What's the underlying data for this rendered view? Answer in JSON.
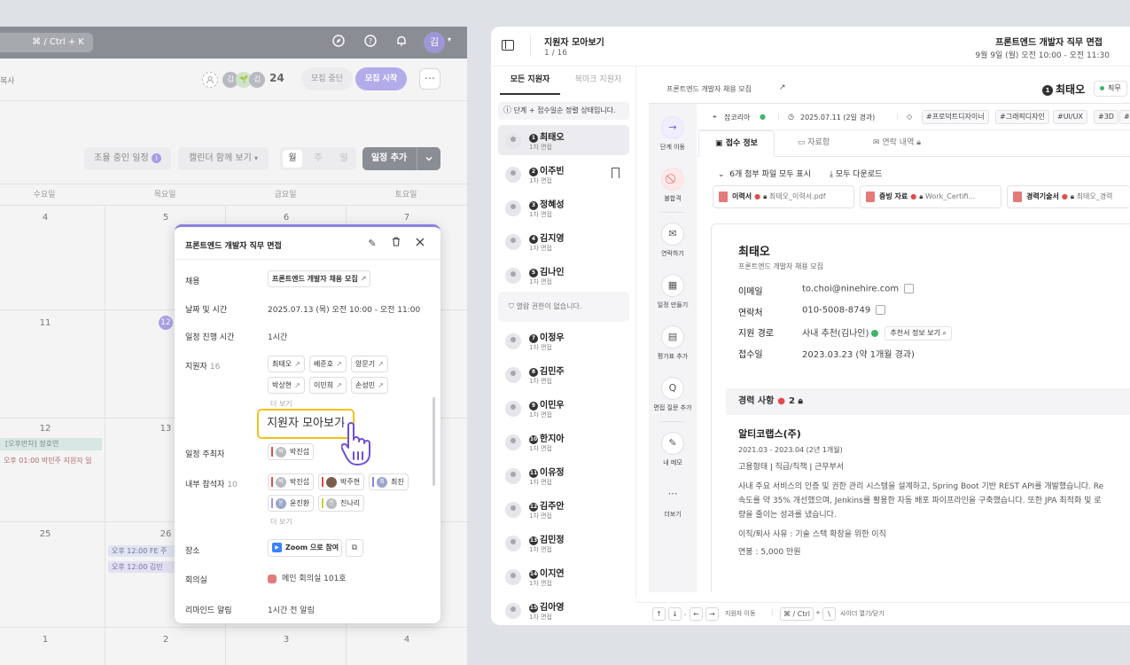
{
  "calendar": {
    "search_shortcut": "⌘ / Ctrl + K",
    "avatar_initial": "김",
    "copy_label": "복사",
    "member_avatars": [
      "김",
      "🌱",
      "김"
    ],
    "member_count": "24",
    "close_recruit": "모집 중단",
    "start_recruit": "모집 시작",
    "coordinating": "조율 중인 일정",
    "calendar_view": "캘린더 함께 보기",
    "view_month": "월",
    "view_week": "주",
    "view_day": "일",
    "add_schedule": "일정 추가",
    "day_names": [
      "수요일",
      "목요일",
      "금요일",
      "토요일"
    ],
    "dates_row1": [
      "4",
      "5",
      "6",
      "7"
    ],
    "dates_row2": [
      "11",
      "12"
    ],
    "dates_row3": [
      "12",
      "13"
    ],
    "dates_row4": [
      "25",
      "26"
    ],
    "dates_row5": [
      "1",
      "2",
      "3",
      "4"
    ],
    "events": {
      "e1": "[오후반차] 정호연",
      "e2": "오후 01:00  박민주 지원자 일",
      "e3": "오후 12:00  FE 주",
      "e4": "오후 12:00  김민"
    }
  },
  "popup": {
    "title": "프론트엔드 개발자 직무 면접",
    "label_recruit": "채용",
    "recruit_value": "프론트엔드 개발자 채용 모집",
    "label_datetime": "날짜 및 시간",
    "datetime_value": "2025.07.13 (목) 오전 10:00 - 오전 11:00",
    "label_duration": "일정 진행 시간",
    "duration_value": "1시간",
    "label_applicants": "지원자",
    "applicant_count": "16",
    "applicants": [
      "최태오",
      "배준호",
      "양문기",
      "박상현",
      "이민희",
      "손성민"
    ],
    "more": "더 보기",
    "collect_view": "지원자 모아보기",
    "label_host": "일정 주최자",
    "host": "박진섭",
    "host_initial": "박",
    "label_participants": "내부 참석자",
    "participant_count": "10",
    "participants": [
      "박진섭",
      "박주현",
      "최진",
      "윤진환",
      "진나리"
    ],
    "participant_initials": [
      "박",
      "",
      "최",
      "윤",
      "진"
    ],
    "label_place": "장소",
    "zoom": "Zoom 으로 참여",
    "label_room": "회의실",
    "room_value": "메인 회의실 101호",
    "label_reminder": "리마인드 알림",
    "reminder_value": "1시간 전 알림"
  },
  "window": {
    "title": "지원자 모아보기",
    "page": "1 / 16",
    "interview_title": "프론트엔드 개발자 직무 면접",
    "interview_time": "9월 9일 (월) 오전 10:00 - 오전 11:30",
    "tab_all": "모든 지원자",
    "tab_bookmark": "북마크 지원자",
    "note": "단계 + 접수일순 정렬 상태입니다.",
    "applicants": [
      {
        "num": "1",
        "name": "최태오",
        "stage": "1차 면접"
      },
      {
        "num": "2",
        "name": "이주빈",
        "stage": "1차 면접"
      },
      {
        "num": "3",
        "name": "정혜성",
        "stage": "1차 면접"
      },
      {
        "num": "4",
        "name": "김지영",
        "stage": "1차 면접"
      },
      {
        "num": "5",
        "name": "김나인",
        "stage": "1차 면접"
      },
      {
        "num": "7",
        "name": "이정우",
        "stage": "1차 면접"
      },
      {
        "num": "8",
        "name": "김민주",
        "stage": "1차 면접"
      },
      {
        "num": "9",
        "name": "이민우",
        "stage": "1차 면접"
      },
      {
        "num": "10",
        "name": "한지아",
        "stage": "1차 면접"
      },
      {
        "num": "11",
        "name": "이유정",
        "stage": "1차 면접"
      },
      {
        "num": "12",
        "name": "김주안",
        "stage": "1차 면접"
      },
      {
        "num": "13",
        "name": "김민정",
        "stage": "1차 면접"
      },
      {
        "num": "14",
        "name": "이지연",
        "stage": "1차 면접"
      },
      {
        "num": "15",
        "name": "김아영",
        "stage": "1차 면접"
      }
    ],
    "no_permission": "열람 권한이 없습니다.",
    "footer": {
      "up": "↑",
      "down": "↓",
      "left": "←",
      "right": "→",
      "move_label": "지원자 이동",
      "mod": "⌘ / Ctrl",
      "plus": "+",
      "slash": "\\",
      "sidebar_label": "사이더 열기/닫기"
    }
  },
  "detail": {
    "recruit_name": "프론트엔드 개발자 채용 모집",
    "applicant_num": "1",
    "applicant_name": "최태오",
    "status": "직무",
    "source_site": "잡코리아",
    "applied_date": "2025.07.11 (2일 경과)",
    "tags": [
      "#프로덕트디자이너",
      "#그래픽디자인",
      "#UI/UX",
      "#3D",
      "#"
    ],
    "actions": [
      "단계 이동",
      "불합격",
      "연락하기",
      "일정 만들기",
      "평가표 추가",
      "면접 질문 추가",
      "내 메모",
      "더보기"
    ],
    "tabs": [
      "접수 정보",
      "자료함",
      "연락 내역"
    ],
    "attach_toggle": "6개 첨부 파일 모두 표시",
    "download_all": "모두 다운로드",
    "files": [
      {
        "type": "이력서",
        "name": "최태오_이력서.pdf"
      },
      {
        "type": "증빙 자료",
        "name": "Work_Certifi..."
      },
      {
        "type": "경력기술서",
        "name": "최태오_경력"
      }
    ],
    "name": "최태오",
    "recruit_sub": "프론트엔드 개발자 채용 모집",
    "label_email": "이메일",
    "email": "to.choi@ninehire.com",
    "label_phone": "연락처",
    "phone": "010-5008-8749",
    "label_route": "지원 경로",
    "route": "사내 추천(김나인)",
    "route_btn": "추천서 정보 보기",
    "label_date": "접수일",
    "applied": "2023.03.23 (약 1개월 경과)",
    "career_title": "경력 사항",
    "career_count": "2",
    "company": "알티코랩스(주)",
    "period": "2021.03 - 2023.04 (2년 1개월)",
    "employment": "고용형태  ǀ  직급/직책  ǀ  근무부서",
    "desc1": "사내 주요 서비스의 인증 및 권한 관리 시스템을 설계하고, Spring Boot 기반 REST API를 개발했습니다. Re",
    "desc2": "속도를 약 35% 개선했으며, Jenkins를 활용한 자동 배포 파이프라인을 구축했습니다. 또한 JPA 최적화 및 로",
    "desc3": "량을 줄이는 성과를 냈습니다.",
    "reason": "이직/퇴사 사유 : 기술 스택 확장을 위한 이직",
    "salary": "연봉 : 5,000 만원"
  },
  "colors": {
    "accent": "#8b80e0",
    "highlight": "#f1c21b",
    "required": "#e24c4c",
    "verified": "#3fb36b"
  }
}
